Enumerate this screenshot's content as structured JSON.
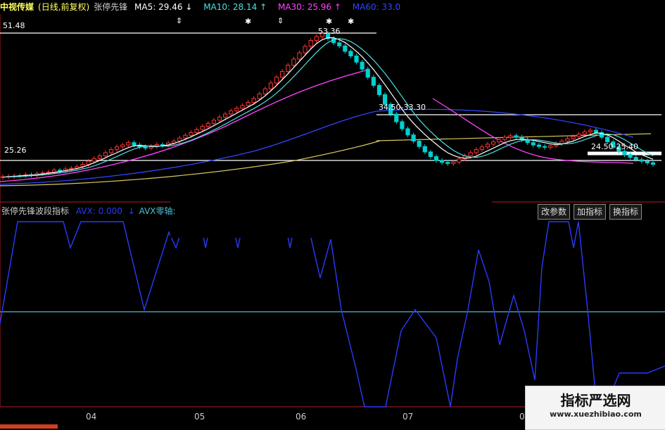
{
  "header": {
    "stock": "中视传媒",
    "period": "(日线,前复权)",
    "indicator_name": "张停先锋",
    "ma5_label": "MA5:",
    "ma5_value": "29.46",
    "ma5_arrow": "↓",
    "ma10_label": "MA10:",
    "ma10_value": "28.14",
    "ma10_arrow": "↑",
    "ma30_label": "MA30:",
    "ma30_value": "25.96",
    "ma30_arrow": "↑",
    "ma60_label": "MA60:",
    "ma60_value": "33.0"
  },
  "lower_panel": {
    "title": "张停先锋波段指标",
    "avx_label": "AVX: 0.000",
    "avx_arrow": "↓",
    "avx_zero_label": "AVX零轴:"
  },
  "buttons": {
    "modify": "改参数",
    "add": "加指标",
    "switch": "换指标"
  },
  "watermark": {
    "title": "指标严选网",
    "url": "www.xuezhibiao.com"
  },
  "colors": {
    "up": "#ff3333",
    "down": "#00d0d0",
    "ma5": "#ffffff",
    "ma10": "#4de0e0",
    "ma30": "#ff44ff",
    "ma60": "#3344ff",
    "ma120": "#d8c860",
    "avx": "#2a3aff",
    "zero_axis": "#4dbfd6",
    "axis": "#b0202a"
  },
  "chart_data": {
    "type": "candlestick",
    "price_labels": [
      "51.48",
      "53.36",
      "25.26",
      "34.50-33.30",
      "24.50-25.40"
    ],
    "x_ticks": [
      "04",
      "05",
      "06",
      "07",
      "0"
    ],
    "reference_levels": [
      25.26
    ],
    "peak_value": 53.36,
    "ylim": [
      12,
      56
    ],
    "close": [
      15.8,
      15.9,
      16.0,
      16.1,
      16.3,
      16.2,
      16.6,
      16.8,
      17.0,
      17.5,
      17.3,
      17.8,
      18.0,
      18.4,
      19.0,
      19.8,
      20.5,
      21.2,
      22.0,
      22.8,
      23.5,
      24.0,
      24.6,
      24.0,
      23.5,
      23.2,
      23.6,
      24.1,
      23.8,
      24.5,
      25.0,
      25.8,
      26.5,
      27.2,
      28.0,
      28.8,
      29.6,
      30.4,
      31.2,
      32.0,
      32.8,
      33.5,
      34.2,
      35.0,
      36.0,
      37.2,
      38.5,
      40.0,
      41.5,
      43.0,
      44.6,
      46.2,
      47.8,
      49.5,
      51.0,
      52.0,
      52.8,
      51.5,
      50.4,
      49.6,
      48.2,
      47.0,
      45.4,
      43.6,
      41.5,
      39.4,
      37.0,
      34.5,
      32.0,
      30.0,
      28.2,
      26.6,
      25.0,
      23.6,
      22.2,
      21.0,
      20.0,
      19.5,
      19.2,
      19.6,
      20.4,
      21.2,
      22.0,
      22.8,
      23.5,
      24.2,
      24.8,
      25.4,
      26.0,
      26.4,
      26.0,
      25.4,
      24.6,
      24.0,
      23.6,
      23.4,
      23.8,
      24.4,
      25.0,
      25.6,
      26.2,
      26.8,
      27.4,
      27.8,
      27.2,
      26.0,
      24.8,
      23.5,
      22.4,
      21.5,
      20.8,
      20.2,
      19.8,
      19.4,
      19.0
    ],
    "ma5": [
      15.7,
      15.8,
      15.9,
      16.0,
      16.1,
      16.2,
      16.3,
      16.5,
      16.7,
      16.9,
      17.1,
      17.4,
      17.6,
      17.9,
      18.3,
      18.8,
      19.4,
      20.0,
      20.7,
      21.4,
      22.0,
      22.7,
      23.3,
      23.8,
      23.9,
      23.8,
      23.6,
      23.6,
      23.8,
      24.0,
      24.4,
      24.9,
      25.5,
      26.1,
      26.8,
      27.5,
      28.2,
      29.0,
      29.8,
      30.6,
      31.4,
      32.2,
      33.0,
      33.8,
      34.6,
      35.6,
      36.7,
      38.0,
      39.4,
      40.9,
      42.4,
      44.0,
      45.6,
      47.2,
      48.8,
      50.2,
      51.2,
      51.7,
      51.7,
      51.2,
      50.5,
      49.4,
      48.2,
      46.8,
      45.2,
      43.5,
      41.6,
      39.6,
      37.5,
      35.4,
      33.2,
      31.3,
      29.6,
      28.1,
      26.7,
      25.4,
      24.2,
      23.0,
      22.0,
      21.3,
      20.8,
      20.6,
      20.7,
      21.1,
      21.8,
      22.5,
      23.2,
      23.9,
      24.6,
      25.1,
      25.4,
      25.5,
      25.4,
      25.2,
      24.9,
      24.6,
      24.3,
      24.1,
      24.2,
      24.6,
      25.0,
      25.6,
      26.2,
      26.7,
      27.1,
      27.0,
      26.6,
      25.9,
      25.0,
      24.0,
      23.1,
      22.2,
      21.5,
      20.9,
      20.3
    ]
  }
}
